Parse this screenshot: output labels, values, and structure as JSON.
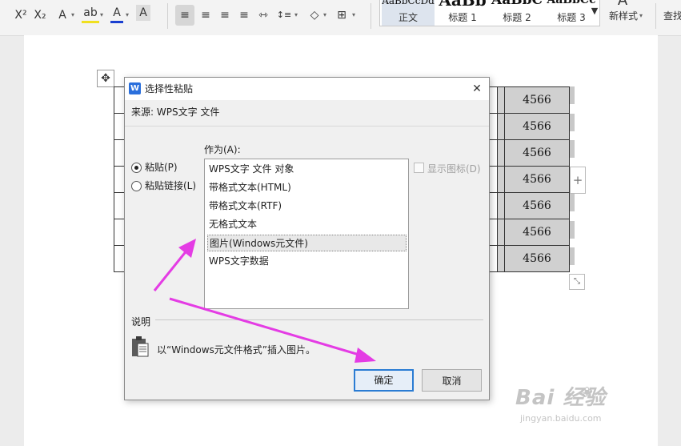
{
  "toolbar": {
    "superscript": "X²",
    "subscript": "X₂",
    "text_effect": "A",
    "highlight": "ab",
    "font_color": "A",
    "char_shading": "A",
    "align_left": "≡",
    "align_center": "≡",
    "align_right": "≡",
    "justify": "≡",
    "distributed": "⇿",
    "line_spacing": "↕≡",
    "shading": "◇",
    "borders": "⊞",
    "styles": [
      {
        "preview": "AaBbCcDd",
        "name": "正文",
        "selected": true
      },
      {
        "preview": "AaBb",
        "name": "标题 1",
        "selected": false
      },
      {
        "preview": "AaBbC",
        "name": "标题 2",
        "selected": false
      },
      {
        "preview": "AaBbCc",
        "name": "标题 3",
        "selected": false
      }
    ],
    "gallery_more": "▼",
    "new_style_icon": "A",
    "new_style_label": "新样式",
    "find_label": "查找"
  },
  "table": {
    "values": [
      "4566",
      "4566",
      "4566",
      "4566",
      "4566",
      "4566",
      "4566"
    ]
  },
  "dialog": {
    "title": "选择性粘贴",
    "close": "✕",
    "source": "来源: WPS文字 文件",
    "paste_option": "粘贴(P)",
    "paste_link_option": "粘贴链接(L)",
    "as_label": "作为(A):",
    "as_options": [
      "WPS文字 文件 对象",
      "带格式文本(HTML)",
      "带格式文本(RTF)",
      "无格式文本",
      "图片(Windows元文件)",
      "WPS文字数据"
    ],
    "selected_index": 4,
    "show_icon_label": "显示图标(D)",
    "description_label": "说明",
    "description_text": "以“Windows元文件格式”插入图片。",
    "ok_label": "确定",
    "cancel_label": "取消"
  },
  "annotation_color": "#e43ce4",
  "watermark": {
    "main": "Bai  经验",
    "sub": "jingyan.baidu.com"
  }
}
